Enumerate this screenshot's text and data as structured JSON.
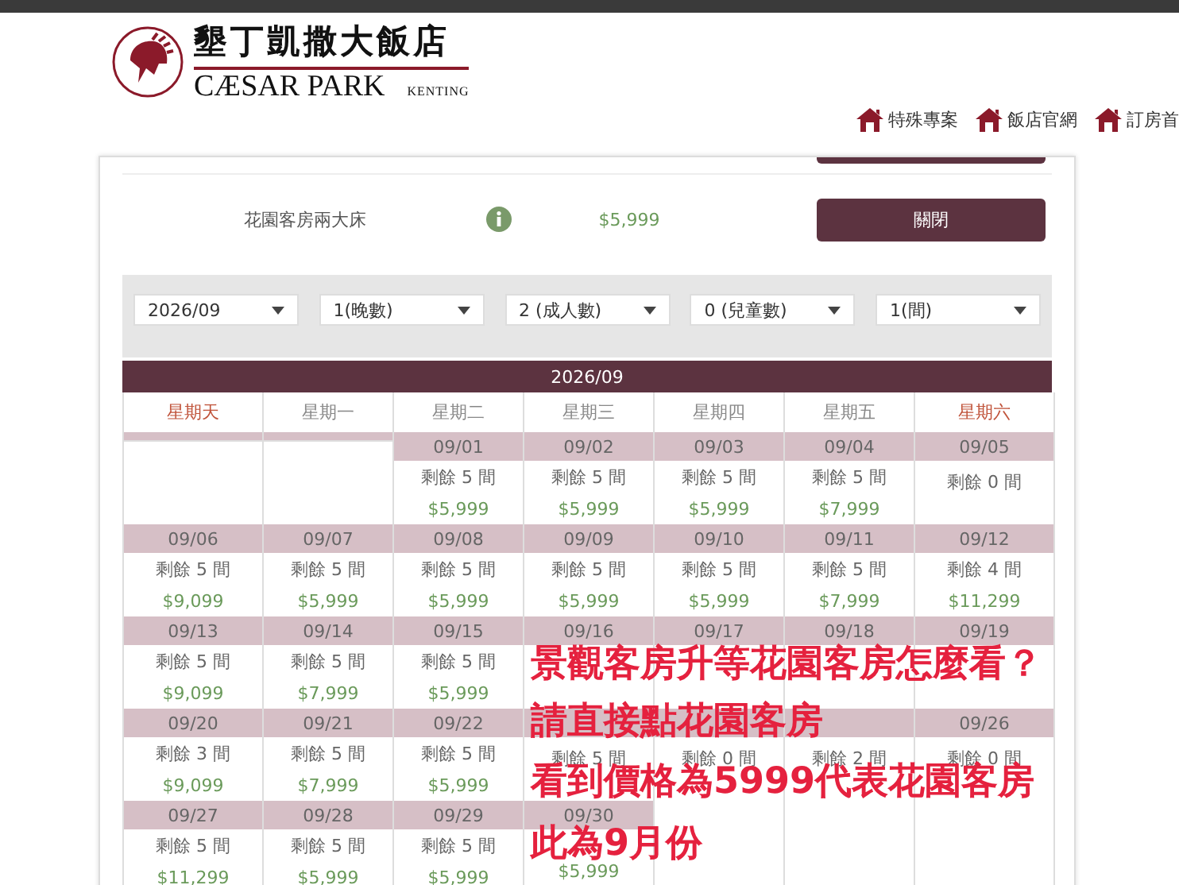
{
  "header": {
    "logo": {
      "name_zh": "墾丁凱撒大飯店",
      "name_en": "CÆSAR PARK",
      "location": "KENTING"
    },
    "nav": [
      {
        "label": "特殊專案"
      },
      {
        "label": "飯店官網"
      },
      {
        "label": "訂房首"
      }
    ]
  },
  "room": {
    "name": "花園客房兩大床",
    "price": "$5,999",
    "button": "關閉"
  },
  "filters": [
    {
      "value": "2026/09"
    },
    {
      "value": "1(晚數)"
    },
    {
      "value": "2 (成人數)"
    },
    {
      "value": "0 (兒童數)"
    },
    {
      "value": "1(間)"
    }
  ],
  "calendar": {
    "title": "2026/09",
    "weekdays": [
      {
        "label": "星期天",
        "weekend": true
      },
      {
        "label": "星期一",
        "weekend": false
      },
      {
        "label": "星期二",
        "weekend": false
      },
      {
        "label": "星期三",
        "weekend": false
      },
      {
        "label": "星期四",
        "weekend": false
      },
      {
        "label": "星期五",
        "weekend": false
      },
      {
        "label": "星期六",
        "weekend": true
      }
    ],
    "weeks": [
      [
        {
          "kind": "leading"
        },
        {
          "kind": "leading"
        },
        {
          "kind": "day",
          "date": "09/01",
          "rooms": "剩餘 5 間",
          "price": "$5,999"
        },
        {
          "kind": "day",
          "date": "09/02",
          "rooms": "剩餘 5 間",
          "price": "$5,999"
        },
        {
          "kind": "day",
          "date": "09/03",
          "rooms": "剩餘 5 間",
          "price": "$5,999"
        },
        {
          "kind": "day",
          "date": "09/04",
          "rooms": "剩餘 5 間",
          "price": "$7,999"
        },
        {
          "kind": "day",
          "date": "09/05",
          "rooms": "剩餘 0 間"
        }
      ],
      [
        {
          "kind": "day",
          "date": "09/06",
          "rooms": "剩餘 5 間",
          "price": "$9,099"
        },
        {
          "kind": "day",
          "date": "09/07",
          "rooms": "剩餘 5 間",
          "price": "$5,999"
        },
        {
          "kind": "day",
          "date": "09/08",
          "rooms": "剩餘 5 間",
          "price": "$5,999"
        },
        {
          "kind": "day",
          "date": "09/09",
          "rooms": "剩餘 5 間",
          "price": "$5,999"
        },
        {
          "kind": "day",
          "date": "09/10",
          "rooms": "剩餘 5 間",
          "price": "$5,999"
        },
        {
          "kind": "day",
          "date": "09/11",
          "rooms": "剩餘 5 間",
          "price": "$7,999"
        },
        {
          "kind": "day",
          "date": "09/12",
          "rooms": "剩餘 4 間",
          "price": "$11,299"
        }
      ],
      [
        {
          "kind": "day",
          "date": "09/13",
          "rooms": "剩餘 5 間",
          "price": "$9,099"
        },
        {
          "kind": "day",
          "date": "09/14",
          "rooms": "剩餘 5 間",
          "price": "$7,999"
        },
        {
          "kind": "day",
          "date": "09/15",
          "rooms": "剩餘 5 間",
          "price": "$5,999"
        },
        {
          "kind": "day",
          "date": "09/16"
        },
        {
          "kind": "day",
          "date": "09/17"
        },
        {
          "kind": "day",
          "date": "09/18"
        },
        {
          "kind": "day",
          "date": "09/19"
        }
      ],
      [
        {
          "kind": "day",
          "date": "09/20",
          "rooms": "剩餘 3 間",
          "price": "$9,099"
        },
        {
          "kind": "day",
          "date": "09/21",
          "rooms": "剩餘 5 間",
          "price": "$7,999"
        },
        {
          "kind": "day",
          "date": "09/22",
          "rooms": "剩餘 5 間",
          "price": "$5,999"
        },
        {
          "kind": "day",
          "rooms": "剩餘 5 間"
        },
        {
          "kind": "day",
          "rooms": "剩餘 0 間"
        },
        {
          "kind": "day",
          "rooms": "剩餘 2 間"
        },
        {
          "kind": "day",
          "date": "09/26",
          "rooms": "剩餘 0 間"
        }
      ],
      [
        {
          "kind": "day",
          "date": "09/27",
          "rooms": "剩餘 5 間",
          "price": "$11,299"
        },
        {
          "kind": "day",
          "date": "09/28",
          "rooms": "剩餘 5 間",
          "price": "$5,999"
        },
        {
          "kind": "day",
          "date": "09/29",
          "rooms": "剩餘 5 間",
          "price": "$5,999"
        },
        {
          "kind": "day",
          "date": "09/30",
          "price": "$5,999"
        },
        {
          "kind": "trailing"
        },
        {
          "kind": "trailing"
        },
        {
          "kind": "trailing"
        }
      ]
    ]
  },
  "annotation": {
    "lines": [
      "景觀客房升等花園客房怎麼看？",
      "請直接點花園客房",
      "看到價格為5999代表花園客房",
      "此為9月份"
    ]
  }
}
